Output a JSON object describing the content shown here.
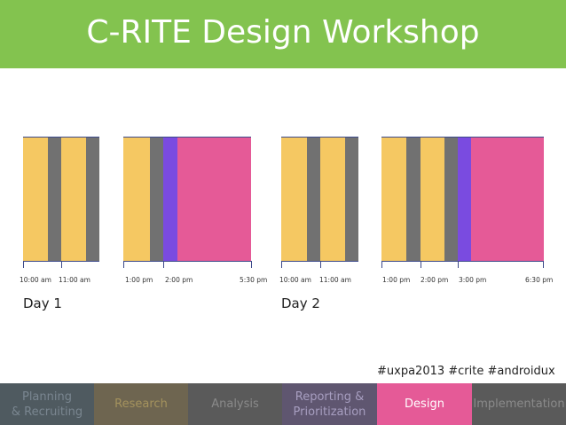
{
  "header": {
    "title": "C-RITE Design Workshop"
  },
  "colors": {
    "header_bg": "#83c34f",
    "research": "#f5c862",
    "discussion": "#717171",
    "review": "#7a4be0",
    "design": "#e55a97",
    "axis": "#3d4a8a"
  },
  "days": [
    {
      "label": "Day 1",
      "time_labels": [
        "10:00 am",
        "11:00 am",
        "1:00 pm",
        "2:00 pm",
        "5:30 pm"
      ]
    },
    {
      "label": "Day 2",
      "time_labels": [
        "10:00 am",
        "11:00 am",
        "1:00 pm",
        "2:00 pm",
        "3:00 pm",
        "6:30 pm"
      ]
    }
  ],
  "hashtags": "#uxpa2013 #crite #androidux",
  "nav": {
    "items": [
      {
        "label": "Planning\n& Recruiting",
        "bg": "#4f5a60",
        "fg": "#7a8690",
        "active": false
      },
      {
        "label": "Research",
        "bg": "#6e6550",
        "fg": "#a4925d",
        "active": false
      },
      {
        "label": "Analysis",
        "bg": "#5a5a5a",
        "fg": "#8a8a8a",
        "active": false
      },
      {
        "label": "Reporting &\nPrioritization",
        "bg": "#5f5670",
        "fg": "#a79ec0",
        "active": false
      },
      {
        "label": "Design",
        "bg": "#e55a97",
        "fg": "#ffffff",
        "active": true
      },
      {
        "label": "Implementation",
        "bg": "#5a5a5a",
        "fg": "#8a8a8a",
        "active": false
      }
    ]
  }
}
